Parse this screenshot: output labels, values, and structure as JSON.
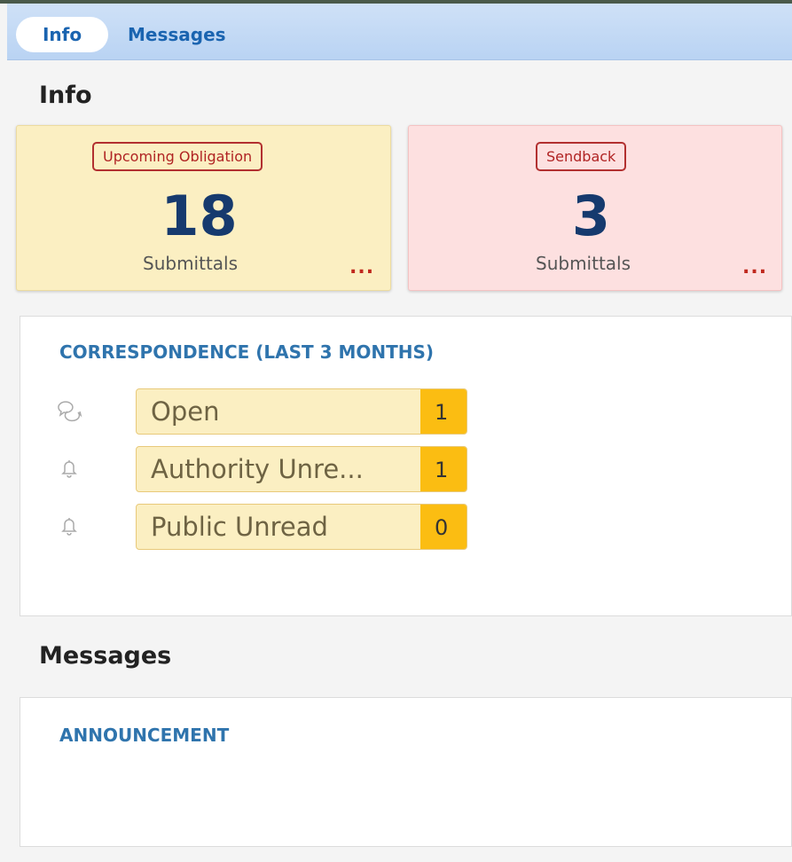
{
  "tabs": [
    {
      "label": "Info",
      "active": true
    },
    {
      "label": "Messages",
      "active": false
    }
  ],
  "info": {
    "title": "Info",
    "cards": [
      {
        "badge": "Upcoming Obligation",
        "count": "18",
        "unit": "Submittals",
        "more": "...",
        "color": "#fbefc2"
      },
      {
        "badge": "Sendback",
        "count": "3",
        "unit": "Submittals",
        "more": "...",
        "color": "#fde0e0"
      }
    ],
    "correspondence": {
      "heading": "CORRESPONDENCE (LAST 3 MONTHS)",
      "items": [
        {
          "icon": "chat-bubbles-icon",
          "label": "Open",
          "count": "1"
        },
        {
          "icon": "bell-icon",
          "label": "Authority Unre...",
          "count": "1"
        },
        {
          "icon": "bell-icon",
          "label": "Public Unread",
          "count": "0"
        }
      ]
    }
  },
  "messages": {
    "title": "Messages",
    "announcement_heading": "ANNOUNCEMENT"
  },
  "colors": {
    "accent_blue": "#2f74ad",
    "count_badge": "#fbbd12",
    "alert_red": "#b02323"
  }
}
